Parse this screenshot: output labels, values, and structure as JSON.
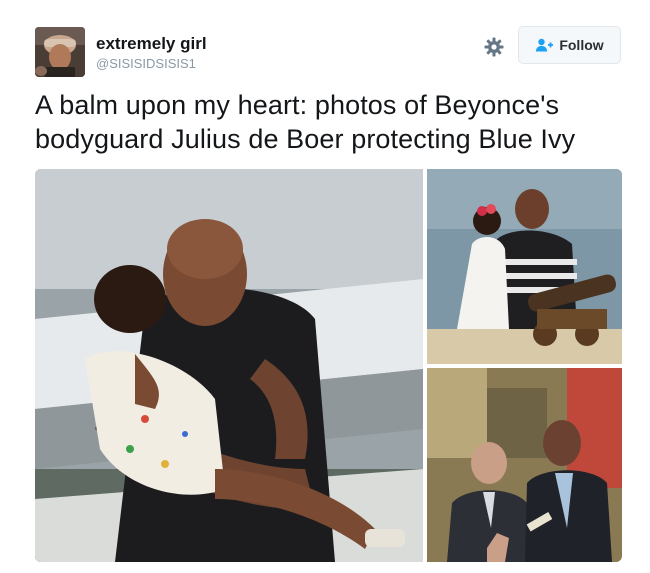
{
  "author": {
    "display_name": "extremely girl",
    "handle": "@SISISIDSISIS1"
  },
  "actions": {
    "follow_label": "Follow"
  },
  "tweet": {
    "text_line1": "A balm upon my heart: photos of Beyonce's",
    "text_line2": "bodyguard Julius de Boer protecting Blue Ivy"
  },
  "icons": {
    "settings": "gear-icon",
    "follow": "add-person-icon"
  },
  "colors": {
    "accent": "#1da1f2",
    "name_text": "#14171a",
    "handle_text": "#8899a6",
    "button_bg": "#f5f8fa",
    "button_border": "#e1e8ed"
  }
}
